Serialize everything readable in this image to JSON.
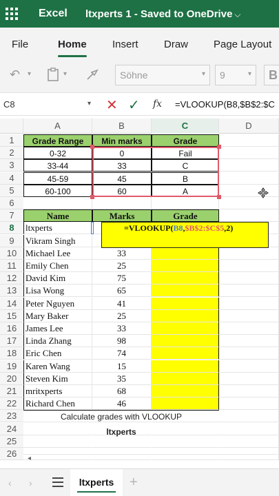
{
  "titlebar": {
    "app_name": "Excel",
    "doc_title": "ltxperts 1  -  Saved to OneDrive"
  },
  "tabs": [
    {
      "label": "File"
    },
    {
      "label": "Home"
    },
    {
      "label": "Insert"
    },
    {
      "label": "Draw"
    },
    {
      "label": "Page Layout"
    }
  ],
  "toolbar": {
    "font_name": "Söhne",
    "font_size": "9",
    "bold_label": "B"
  },
  "formula_bar": {
    "name_box": "C8",
    "fx_label": "fx",
    "formula": "=VLOOKUP(B8,$B$2:$C"
  },
  "grid": {
    "columns": [
      "A",
      "B",
      "C",
      "D"
    ],
    "selected_column": "C",
    "selected_row": "8",
    "rows": [
      "1",
      "2",
      "3",
      "4",
      "5",
      "6",
      "7",
      "8",
      "9",
      "10",
      "11",
      "12",
      "13",
      "14",
      "15",
      "16",
      "17",
      "18",
      "19",
      "20",
      "21",
      "22",
      "23",
      "24",
      "25",
      "26"
    ]
  },
  "grade_table": {
    "headers": [
      "Grade Range",
      "Min marks",
      "Grade"
    ],
    "rows": [
      [
        "0-32",
        "0",
        "Fail"
      ],
      [
        "33-44",
        "33",
        "C"
      ],
      [
        "45-59",
        "45",
        "B"
      ],
      [
        "60-100",
        "60",
        "A"
      ]
    ]
  },
  "student_table": {
    "headers": [
      "Name",
      "Marks",
      "Grade"
    ],
    "rows": [
      [
        "ltxperts",
        ""
      ],
      [
        "Vikram Singh",
        ""
      ],
      [
        "Michael Lee",
        "33"
      ],
      [
        "Emily Chen",
        "25"
      ],
      [
        "David Kim",
        "75"
      ],
      [
        "Lisa Wong",
        "65"
      ],
      [
        "Peter Nguyen",
        "41"
      ],
      [
        "Mary Baker",
        "25"
      ],
      [
        "James Lee",
        "33"
      ],
      [
        "Linda Zhang",
        "98"
      ],
      [
        "Eric Chen",
        "74"
      ],
      [
        "Karen Wang",
        "15"
      ],
      [
        "Steven Kim",
        "35"
      ],
      [
        "mritxperts",
        "68"
      ],
      [
        "Richard Chen",
        "46"
      ]
    ]
  },
  "formula_overlay": {
    "prefix": "=VLOOKUP(",
    "ref1": "B8",
    "sep1": ",",
    "ref2": "$B$2:$C$5",
    "suffix": ",2)"
  },
  "caption": {
    "line1": "Calculate grades with VLOOKUP",
    "line2": "ltxperts"
  },
  "sheetbar": {
    "sheet_name": "ltxperts"
  },
  "colors": {
    "accent": "#1e7145",
    "header_green": "#9bd16d",
    "highlight": "#ffff00",
    "range_red": "#e05a6a",
    "ref_blue": "#4a7fd6"
  }
}
